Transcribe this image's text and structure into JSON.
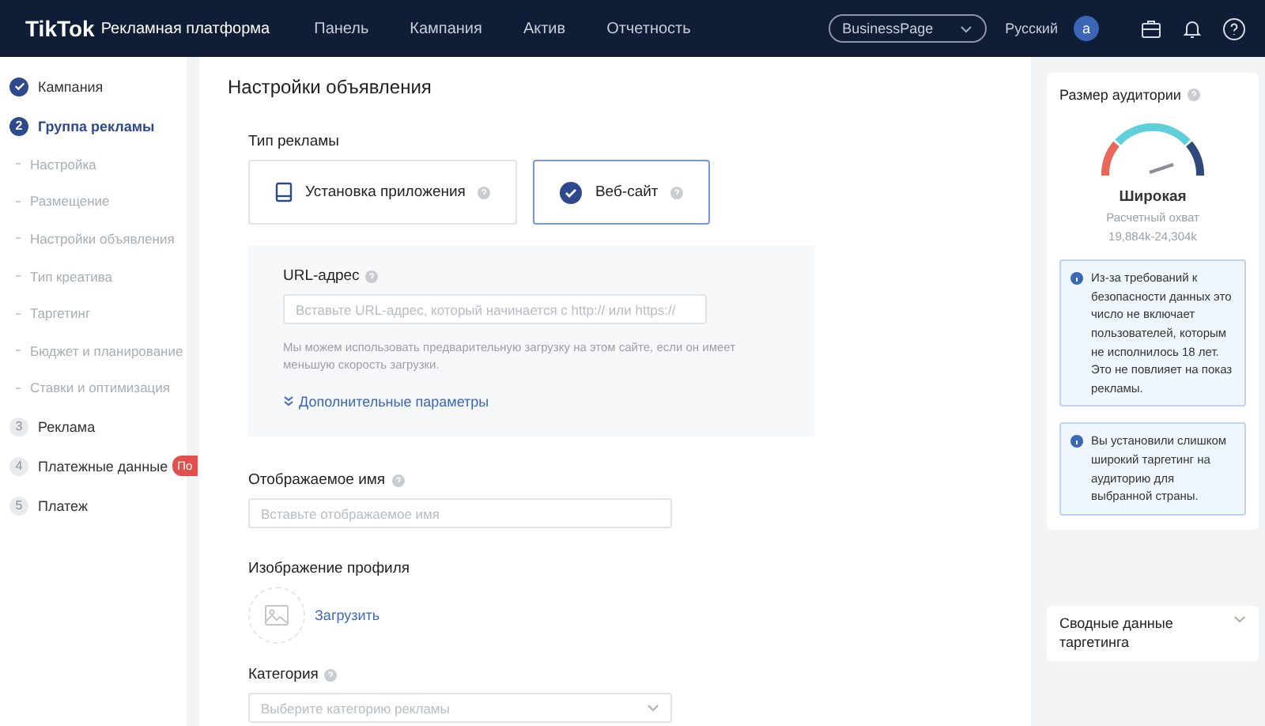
{
  "header": {
    "logo": "TikTok",
    "logo_suffix": "Рекламная платформа",
    "nav": [
      "Панель",
      "Кампания",
      "Актив",
      "Отчетность"
    ],
    "account": "BusinessPage",
    "language": "Русский",
    "avatar": "a"
  },
  "sidebar": {
    "steps": [
      {
        "label": "Кампания",
        "completed": true,
        "selected": false
      },
      {
        "number": "2",
        "label": "Группа рекламы",
        "completed": false,
        "selected": true,
        "children": [
          {
            "label": "Настройка"
          },
          {
            "label": "Размещение"
          },
          {
            "label": "Настройки объявления"
          },
          {
            "label": "Тип креатива"
          },
          {
            "label": "Таргетинг"
          },
          {
            "label": "Бюджет и планирование"
          },
          {
            "label": "Ставки и оптимизация"
          }
        ]
      },
      {
        "number": "3",
        "label": "Реклама",
        "completed": false,
        "selected": false
      },
      {
        "number": "4",
        "label": "Платежные данные",
        "completed": false,
        "selected": false,
        "badge": "По"
      },
      {
        "number": "5",
        "label": "Платеж",
        "completed": false,
        "selected": false
      }
    ]
  },
  "main": {
    "title": "Настройки объявления",
    "ad_type": {
      "label": "Тип рекламы",
      "options": [
        {
          "kind": "app",
          "label": "Установка приложения",
          "selected": false
        },
        {
          "label": "Веб-сайт",
          "selected": true
        }
      ]
    },
    "url": {
      "label": "URL-адрес",
      "placeholder": "Вставьте URL-адрес, который начинается с http:// или https://",
      "hint": "Мы можем использовать предварительную загрузку на этом сайте, если он имеет меньшую скорость загрузки.",
      "more_link": "Дополнительные параметры"
    },
    "display_name": {
      "label": "Отображаемое имя",
      "placeholder": "Вставьте отображаемое имя"
    },
    "profile_image": {
      "label": "Изображение профиля",
      "upload": "Загрузить"
    },
    "category": {
      "label": "Категория",
      "placeholder": "Выберите категорию рекламы"
    }
  },
  "audience": {
    "title": "Размер аудитории",
    "size_label": "Широкая",
    "reach_label": "Расчетный охват",
    "reach": "19,884k-24,304k",
    "notices": [
      "Из-за требований к безопасности данных это число не включает пользователей, которым не исполнилось 18 лет. Это не повлияет на показ рекламы.",
      "Вы установили слишком широкий таргетинг на аудиторию для выбранной страны."
    ]
  },
  "summary": {
    "title": "Сводные данные таргетинга",
    "expanded": false
  }
}
